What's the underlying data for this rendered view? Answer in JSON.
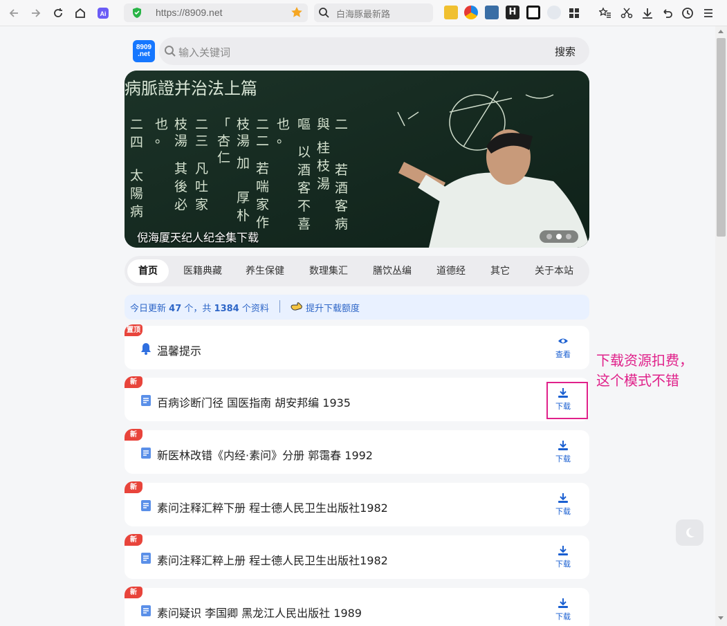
{
  "browser": {
    "url": "https://8909.net",
    "search_query": "白海豚最新路"
  },
  "site": {
    "logo_line1": "8909",
    "logo_line2": ".net",
    "search_placeholder": "输入关键词",
    "search_button": "搜索",
    "banner_caption": "倪海厦天纪人纪全集下载",
    "banner_slide_active": 2,
    "banner_slide_count": 3,
    "nav": [
      "首页",
      "医籍典藏",
      "养生保健",
      "数理集汇",
      "膳饮丛编",
      "道德经",
      "其它",
      "关于本站"
    ],
    "stats": {
      "prefix": "今日更新",
      "today": "47",
      "mid": "个，共",
      "total": "1384",
      "suffix": "个资料",
      "link": "提升下载额度"
    },
    "items": [
      {
        "tag": "置顶",
        "title": "温馨提示",
        "action": "查看",
        "icon": "bell-icon"
      },
      {
        "tag": "新",
        "title": "百病诊断门径 国医指南 胡安邦编 1935",
        "action": "下载",
        "icon": "book-icon"
      },
      {
        "tag": "新",
        "title": "新医林改错《内经·素问》分册 郭霭春 1992",
        "action": "下载",
        "icon": "book-icon"
      },
      {
        "tag": "新",
        "title": "素问注释汇粹下册 程士德人民卫生出版社1982",
        "action": "下载",
        "icon": "book-icon"
      },
      {
        "tag": "新",
        "title": "素问注释汇粹上册 程士德人民卫生出版社1982",
        "action": "下载",
        "icon": "book-icon"
      },
      {
        "tag": "新",
        "title": "素问疑识 李国卿 黑龙江人民出版社 1989",
        "action": "下载",
        "icon": "book-icon"
      }
    ]
  },
  "annotation": {
    "line1": "下载资源扣费，",
    "line2": "这个模式不错"
  },
  "colors": {
    "accent": "#1677ff",
    "tag_red": "#e8443b",
    "annotation_pink": "#e0218a",
    "link_blue": "#2e66c7"
  }
}
